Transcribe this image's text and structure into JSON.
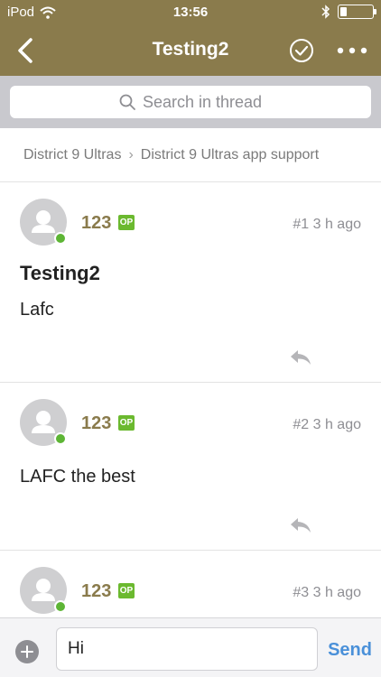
{
  "status_bar": {
    "carrier": "iPod",
    "time": "13:56",
    "battery_level": 0.2
  },
  "nav": {
    "title": "Testing2"
  },
  "search": {
    "placeholder": "Search in thread"
  },
  "breadcrumb": {
    "items": [
      "District 9 Ultras",
      "District 9 Ultras app support"
    ]
  },
  "posts": [
    {
      "username": "123",
      "badge": "OP",
      "number": "#1",
      "time": "3 h ago",
      "title": "Testing2",
      "body": "Lafc"
    },
    {
      "username": "123",
      "badge": "OP",
      "number": "#2",
      "time": "3 h ago",
      "body": "LAFC the best"
    },
    {
      "username": "123",
      "badge": "OP",
      "number": "#3",
      "time": "3 h ago"
    }
  ],
  "composer": {
    "value": "Hi",
    "send_label": "Send"
  },
  "colors": {
    "brand": "#8a7b4c",
    "op_badge": "#6bb92f",
    "online": "#5db535",
    "send": "#4a90d9"
  }
}
